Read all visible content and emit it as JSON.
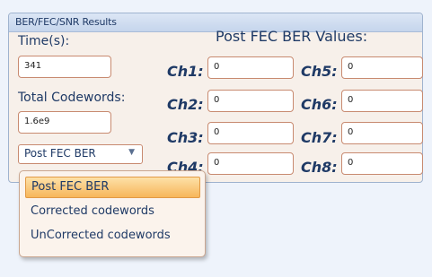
{
  "panel": {
    "title": "BER/FEC/SNR Results"
  },
  "time": {
    "label": "Time(s):",
    "value": "341"
  },
  "codewords": {
    "label": "Total Codewords:",
    "value": "1.6e9"
  },
  "select": {
    "value": "Post FEC BER",
    "arrow_icon": "chevron-down-icon"
  },
  "values_heading": "Post FEC BER Values:",
  "channels": [
    {
      "label": "Ch1:",
      "value": "0"
    },
    {
      "label": "Ch2:",
      "value": "0"
    },
    {
      "label": "Ch3:",
      "value": "0"
    },
    {
      "label": "Ch4:",
      "value": "0"
    },
    {
      "label": "Ch5:",
      "value": "0"
    },
    {
      "label": "Ch6:",
      "value": "0"
    },
    {
      "label": "Ch7:",
      "value": "0"
    },
    {
      "label": "Ch8:",
      "value": "0"
    }
  ],
  "dropdown": {
    "options": [
      "Post FEC BER",
      "Corrected codewords",
      "UnCorrected codewords"
    ],
    "selected_index": 0
  }
}
